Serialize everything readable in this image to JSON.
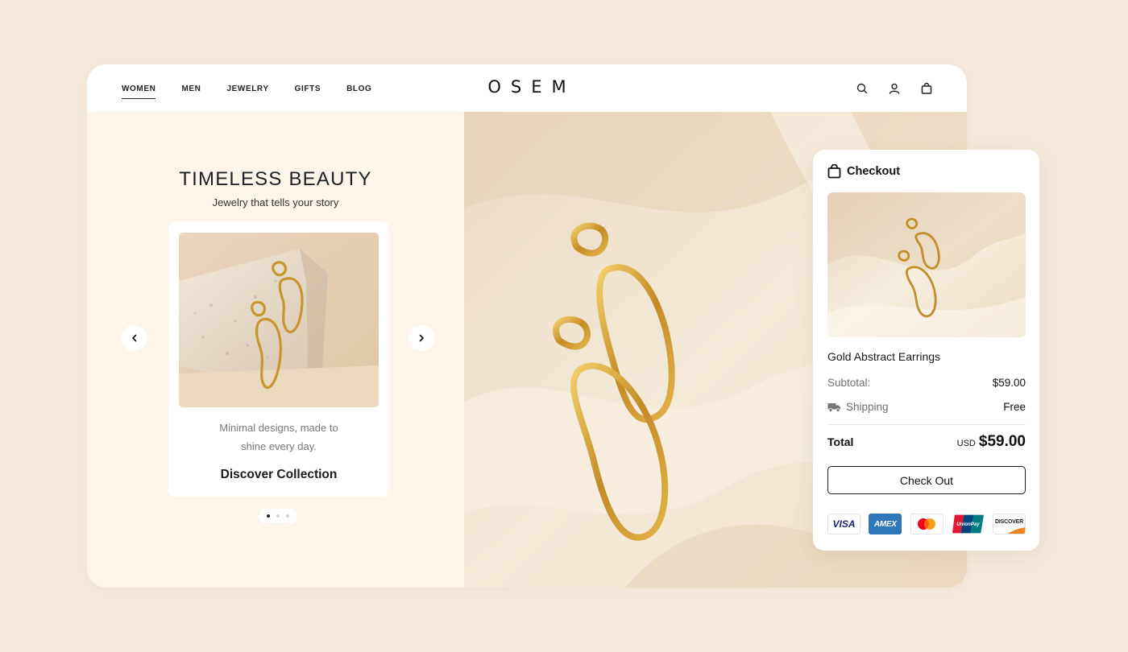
{
  "nav": {
    "links": [
      "WOMEN",
      "MEN",
      "JEWELRY",
      "GIFTS",
      "BLOG"
    ],
    "active_index": 0,
    "logo": "OSEM",
    "icons": [
      "search-icon",
      "user-icon",
      "shopping-bag-icon"
    ]
  },
  "hero": {
    "title": "TIMELESS BEAUTY",
    "subtitle": "Jewelry that tells your story",
    "card": {
      "description_line1": "Minimal designs, made to",
      "description_line2": "shine every day.",
      "cta": "Discover Collection"
    },
    "carousel": {
      "slides": 3,
      "active": 0
    }
  },
  "checkout": {
    "title": "Checkout",
    "product_name": "Gold Abstract Earrings",
    "subtotal_label": "Subtotal:",
    "subtotal_value": "$59.00",
    "shipping_label": "Shipping",
    "shipping_value": "Free",
    "total_label": "Total",
    "total_currency": "USD",
    "total_value": "$59.00",
    "button_label": "Check Out",
    "payment_methods": [
      "VISA",
      "AMEX",
      "Mastercard",
      "UnionPay",
      "DISCOVER"
    ]
  },
  "colors": {
    "background": "#f4e9dd",
    "hero_left_bg": "#fdf5ea",
    "gold": "#c9952e",
    "text_dark": "#1d2228"
  }
}
